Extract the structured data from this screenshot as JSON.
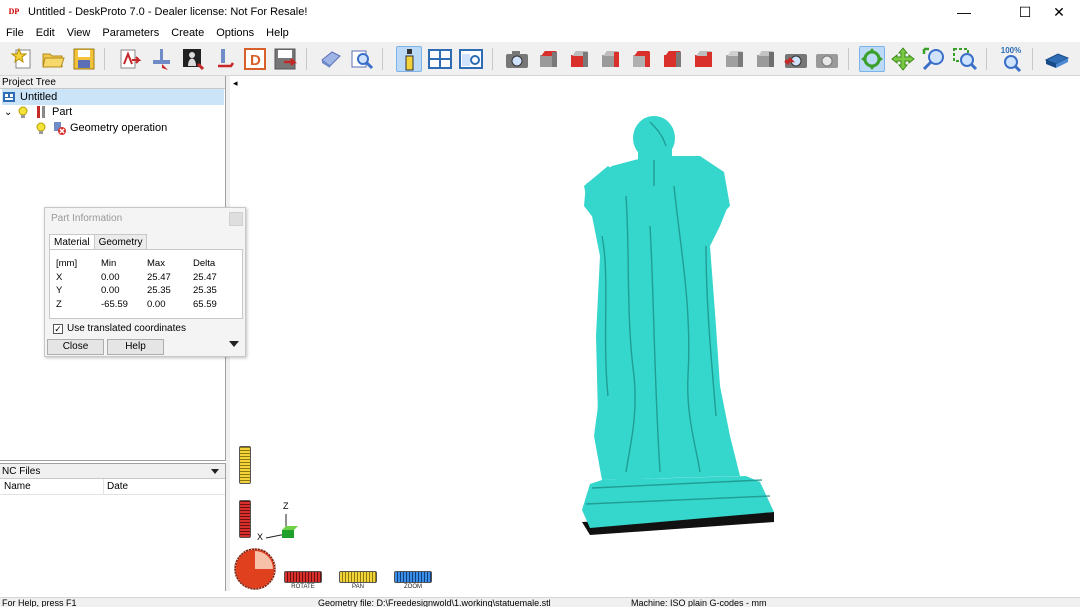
{
  "window": {
    "title": "Untitled - DeskProto 7.0 - Dealer license: Not For Resale!",
    "app_icon_text": "DP",
    "minimize_glyph": "—",
    "maximize_glyph": "☐",
    "close_glyph": "✕"
  },
  "menu": [
    "File",
    "Edit",
    "View",
    "Parameters",
    "Create",
    "Options",
    "Help"
  ],
  "toolbar": {
    "zoom_percent_label": "100%"
  },
  "project_tree": {
    "header": "Project Tree",
    "items": [
      {
        "label": "Untitled"
      },
      {
        "label": "Part"
      },
      {
        "label": "Geometry operation"
      }
    ],
    "expand_glyph": "⌄"
  },
  "nc_files": {
    "header": "NC Files",
    "columns": [
      "Name",
      "Date"
    ]
  },
  "part_info": {
    "title": "Part Information",
    "tabs": [
      "Material",
      "Geometry"
    ],
    "table": {
      "headers": [
        "[mm]",
        "Min",
        "Max",
        "Delta"
      ],
      "rows": [
        [
          "X",
          "0.00",
          "25.47",
          "25.47"
        ],
        [
          "Y",
          "0.00",
          "25.35",
          "25.35"
        ],
        [
          "Z",
          "-65.59",
          "0.00",
          "65.59"
        ]
      ]
    },
    "checkbox_label": "Use translated coordinates",
    "checkbox_checked": true,
    "close_label": "Close",
    "help_label": "Help"
  },
  "viewport": {
    "model_color": "#35d6cc",
    "axis_z_label": "Z",
    "axis_x_label": "X",
    "collapse_glyph": "◂"
  },
  "sliders": {
    "rotate_label": "ROTATE",
    "pan_label": "PAN",
    "zoom_label": "ZOOM"
  },
  "status": {
    "help": "For Help, press F1",
    "geometry_file": "Geometry file: D:\\Freedesignwold\\1.working\\statuemale.stl",
    "machine": "Machine: ISO plain G-codes - mm"
  }
}
